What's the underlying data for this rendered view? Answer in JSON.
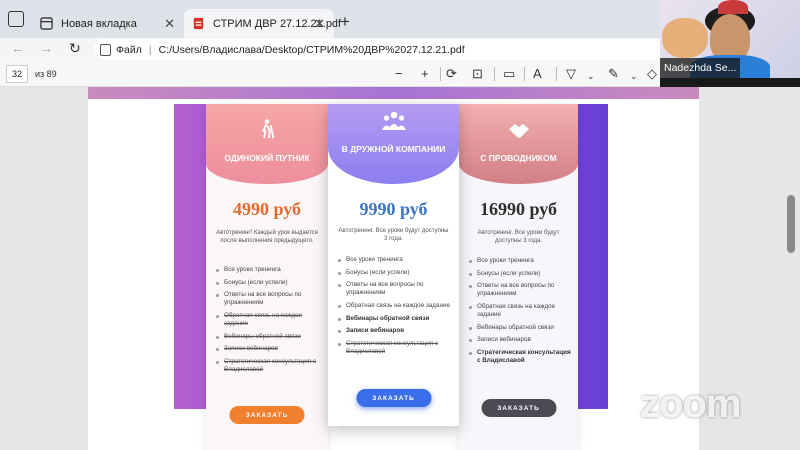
{
  "browser": {
    "tabs": [
      {
        "label": "Новая вкладка"
      },
      {
        "label": "СТРИМ ДВР 27.12.21.pdf"
      }
    ],
    "address": {
      "scheme_label": "Файл",
      "url": "C:/Users/Владислава/Desktop/СТРИМ%20ДВР%2027.12.21.pdf"
    }
  },
  "pdf_toolbar": {
    "page_current": "32",
    "page_total": "из 89"
  },
  "pricing": {
    "cards": [
      {
        "title": "ОДИНОКИЙ ПУТНИК",
        "icon": "hiker-icon",
        "price": "4990 руб",
        "description": "Автотренинг! Каждый урок выдается после выполнения предыдущего.",
        "features": [
          {
            "text": "Все уроки тренинга",
            "style": "normal"
          },
          {
            "text": "Бонусы (если успели)",
            "style": "normal"
          },
          {
            "text": "Ответы на все вопросы по упражнениям",
            "style": "normal"
          },
          {
            "text": "Обратная связь на каждое задание",
            "style": "strike"
          },
          {
            "text": "Вебинары обратной связи",
            "style": "strike"
          },
          {
            "text": "Записи вебинаров",
            "style": "strike"
          },
          {
            "text": "Стратегическая консультация с Владиславой",
            "style": "strike"
          }
        ],
        "button": "ЗАКАЗАТЬ"
      },
      {
        "title": "В ДРУЖНОЙ КОМПАНИИ",
        "icon": "group-icon",
        "price": "9990 руб",
        "description": "Автотренинг. Все уроки будут доступны 3 года.",
        "features": [
          {
            "text": "Все уроки тренинга",
            "style": "normal"
          },
          {
            "text": "Бонусы (если успели)",
            "style": "normal"
          },
          {
            "text": "Ответы на все вопросы по упражнениям",
            "style": "normal"
          },
          {
            "text": "Обратная связь на каждое задание",
            "style": "normal"
          },
          {
            "text": "Вебинары обратной связи",
            "style": "bold"
          },
          {
            "text": "Записи вебинаров",
            "style": "bold"
          },
          {
            "text": "Стратегическая консультация с Владиславой",
            "style": "strike"
          }
        ],
        "button": "ЗАКАЗАТЬ"
      },
      {
        "title": "С ПРОВОДНИКОМ",
        "icon": "handshake-icon",
        "price": "16990 руб",
        "description": "Автотренинг. Все уроки будут доступны 3 года.",
        "features": [
          {
            "text": "Все уроки тренинга",
            "style": "normal"
          },
          {
            "text": "Бонусы (если успели)",
            "style": "normal"
          },
          {
            "text": "Ответы на все вопросы по упражнениям",
            "style": "normal"
          },
          {
            "text": "Обратная связь на каждое задание",
            "style": "normal"
          },
          {
            "text": "Вебинары обратной связи",
            "style": "normal"
          },
          {
            "text": "Записи вебинаров",
            "style": "normal"
          },
          {
            "text": "Стратегическая консультация с Владиславой",
            "style": "bold"
          }
        ],
        "button": "ЗАКАЗАТЬ"
      }
    ]
  },
  "zoom": {
    "participant_name": "Nadezhda Se...",
    "watermark": "zoom"
  }
}
